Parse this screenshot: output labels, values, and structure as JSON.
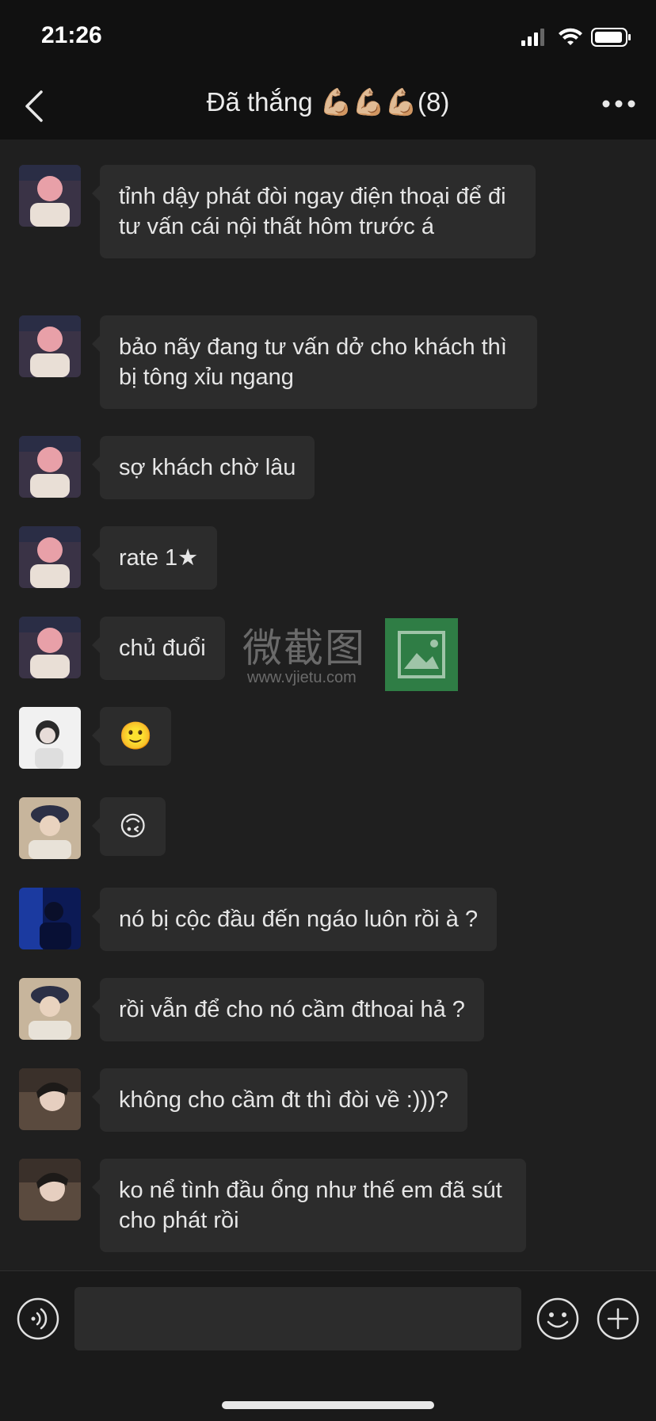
{
  "status_bar": {
    "time": "21:26",
    "icons": [
      "signal-icon",
      "wifi-icon",
      "battery-icon"
    ]
  },
  "header": {
    "title": "Đã thắng 💪🏼💪🏼💪🏼(8)",
    "back_icon": "chevron-left-icon",
    "more_icon": "more-dots-icon"
  },
  "messages": [
    {
      "avatar": "pink-hair-avatar",
      "text": "tỉnh dậy phát đòi ngay điện thoại để đi tư vấn cái nội thất hôm trước á"
    },
    {
      "avatar": "pink-hair-avatar",
      "text": "bảo nãy đang tư vấn dở cho khách thì bị tông xỉu ngang"
    },
    {
      "avatar": "pink-hair-avatar",
      "text": "sợ khách chờ lâu"
    },
    {
      "avatar": "pink-hair-avatar",
      "text": "rate 1★"
    },
    {
      "avatar": "pink-hair-avatar",
      "text": "chủ đuổi"
    },
    {
      "avatar": "white-bg-avatar",
      "text": "🙂"
    },
    {
      "avatar": "cap-boy-avatar",
      "text": "🙃"
    },
    {
      "avatar": "blue-dark-avatar",
      "text": "nó bị cộc đầu đến ngáo luôn rồi à ?"
    },
    {
      "avatar": "cap-boy-avatar",
      "text": "rồi vẫn để cho nó cầm đthoai hả ?"
    },
    {
      "avatar": "profile-boy-avatar",
      "text": "không cho cầm đt thì đòi về :)))?"
    },
    {
      "avatar": "profile-boy-avatar",
      "text": "ko nể tình đầu ổng như thế em đã sút cho phát rồi"
    }
  ],
  "watermark": {
    "chinese": "微截图",
    "url": "www.vjietu.com"
  },
  "input_bar": {
    "placeholder": "",
    "value": "",
    "icons": [
      "voice-icon",
      "emoji-face-icon",
      "plus-icon"
    ]
  },
  "colors": {
    "background": "#1f1f1f",
    "header": "#111111",
    "bubble": "#2c2c2c",
    "text": "#e6e6e6",
    "watermark_green": "#2f7d45"
  }
}
